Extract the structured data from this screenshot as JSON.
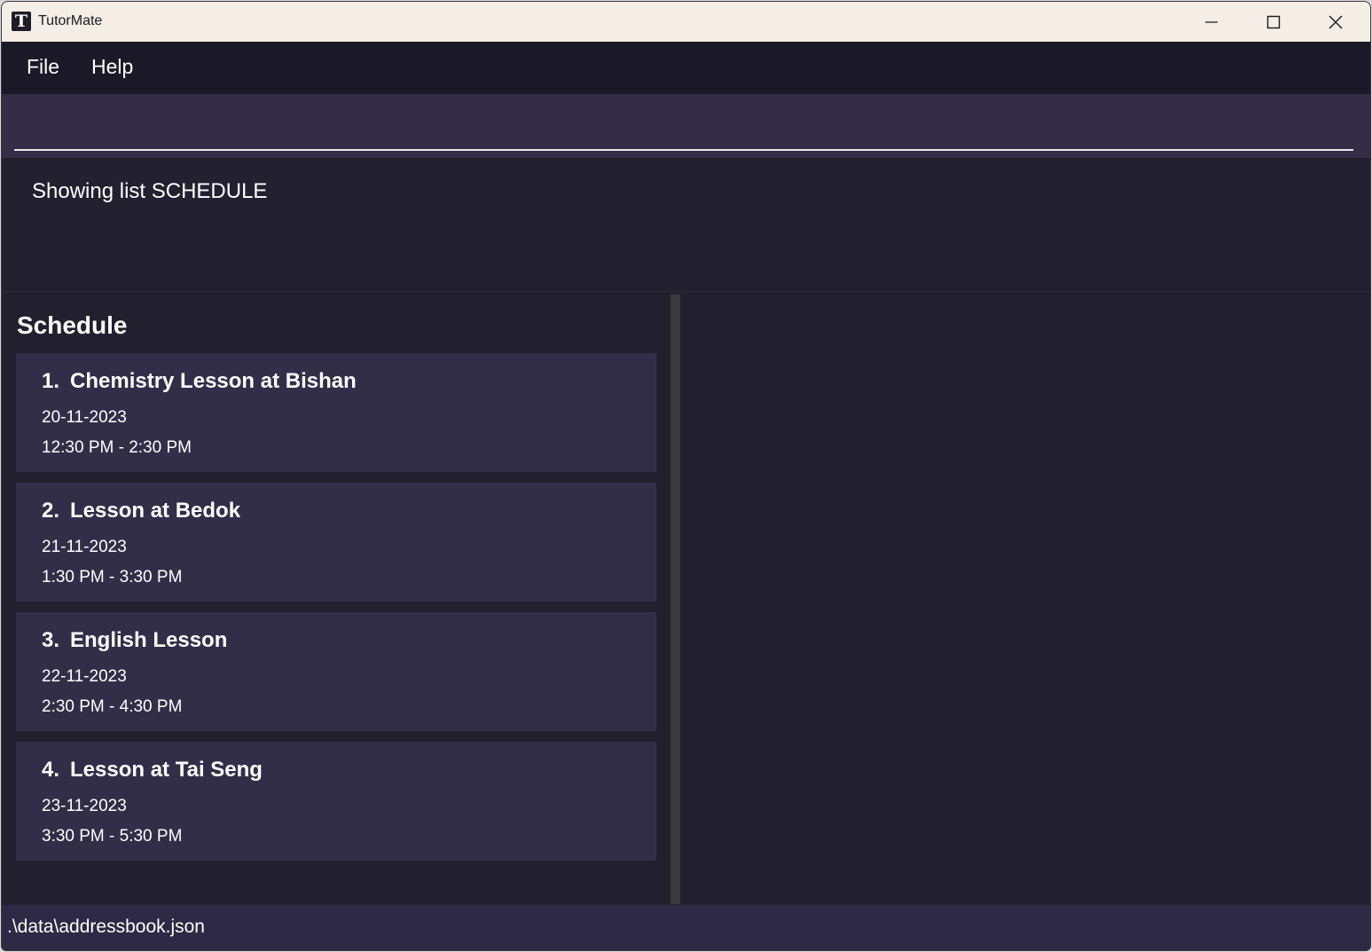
{
  "window": {
    "title": "TutorMate",
    "icon_letter": "T"
  },
  "menu": {
    "file": "File",
    "help": "Help"
  },
  "command": {
    "value": "",
    "placeholder": ""
  },
  "result": {
    "message": "Showing list SCHEDULE"
  },
  "schedule": {
    "title": "Schedule",
    "items": [
      {
        "index": "1.",
        "title": "Chemistry Lesson at Bishan",
        "date": "20-11-2023",
        "time": "12:30 PM - 2:30 PM"
      },
      {
        "index": "2.",
        "title": "Lesson at Bedok",
        "date": "21-11-2023",
        "time": "1:30 PM - 3:30 PM"
      },
      {
        "index": "3.",
        "title": "English Lesson",
        "date": "22-11-2023",
        "time": "2:30 PM - 4:30 PM"
      },
      {
        "index": "4.",
        "title": "Lesson at Tai Seng",
        "date": "23-11-2023",
        "time": "3:30 PM - 5:30 PM"
      }
    ]
  },
  "status": {
    "path": ".\\data\\addressbook.json"
  },
  "colors": {
    "background": "#23202f",
    "card": "#332e48",
    "menubar": "#1b1927",
    "titlebar": "#f5eee6"
  }
}
